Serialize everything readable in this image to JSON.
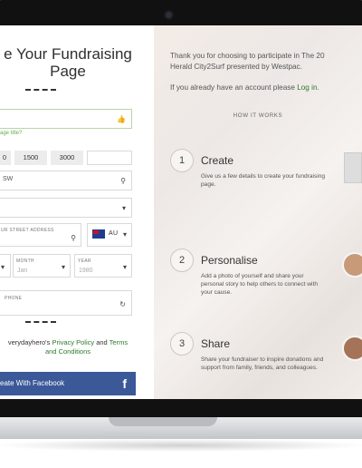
{
  "form": {
    "title_line1": "e Your Fundraising",
    "title_line2": "Page",
    "page_title_hint": "age title?",
    "amounts": [
      "0",
      "1500",
      "3000"
    ],
    "suburb_value": "SW",
    "address_label": "UR STREET ADDRESS",
    "country_code": "AU",
    "month_label": "MONTH",
    "month_value": "Jan",
    "year_label": "YEAR",
    "year_value": "1980",
    "phone_label": "PHONE",
    "terms_prefix": "veryday",
    "terms_hero": "hero's ",
    "privacy_link": "Privacy Policy",
    "terms_and": " and ",
    "terms_link": "Terms",
    "conditions_link": "and Conditions",
    "facebook_button": "eate With Facebook",
    "facebook_icon": "f"
  },
  "info": {
    "intro_line1": "Thank you for choosing to participate in The 20",
    "intro_line2": "Herald City2Surf presented by Westpac.",
    "account_text": "If you already have an account please ",
    "login_link": "Log in",
    "account_suffix": ".",
    "how_it_works": "HOW IT WORKS",
    "steps": [
      {
        "num": "1",
        "title": "Create",
        "desc": "Give us a few details to create your fundraising page."
      },
      {
        "num": "2",
        "title": "Personalise",
        "desc": "Add a photo of yourself and share your personal story to help others to connect with your cause."
      },
      {
        "num": "3",
        "title": "Share",
        "desc": "Share your fundraiser to inspire donations and support from family, friends, and colleagues."
      }
    ]
  },
  "icons": {
    "search": "search-icon",
    "chevron": "chevron-down-icon",
    "refresh": "refresh-icon",
    "thumb": "thumbs-up-icon"
  }
}
